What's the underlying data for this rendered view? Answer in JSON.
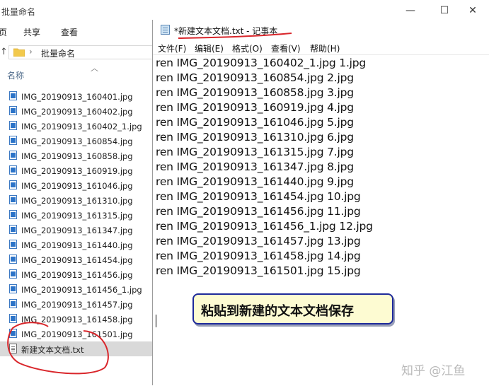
{
  "explorer": {
    "title": "批量命名",
    "ribbon": {
      "left_partial": "页",
      "share": "共享",
      "view": "查看"
    },
    "address": {
      "path_label": "批量命名"
    },
    "column_header": "名称",
    "files": [
      "IMG_20190913_160401.jpg",
      "IMG_20190913_160402.jpg",
      "IMG_20190913_160402_1.jpg",
      "IMG_20190913_160854.jpg",
      "IMG_20190913_160858.jpg",
      "IMG_20190913_160919.jpg",
      "IMG_20190913_161046.jpg",
      "IMG_20190913_161310.jpg",
      "IMG_20190913_161315.jpg",
      "IMG_20190913_161347.jpg",
      "IMG_20190913_161440.jpg",
      "IMG_20190913_161454.jpg",
      "IMG_20190913_161456.jpg",
      "IMG_20190913_161456_1.jpg",
      "IMG_20190913_161457.jpg",
      "IMG_20190913_161458.jpg",
      "IMG_20190913_161501.jpg",
      "新建文本文档.txt"
    ]
  },
  "window_controls": {
    "minimize": "—",
    "maximize": "☐",
    "close": "✕"
  },
  "notepad": {
    "title": "*新建文本文档.txt - 记事本",
    "menu": [
      "文件(F)",
      "编辑(E)",
      "格式(O)",
      "查看(V)",
      "帮助(H)"
    ],
    "lines": [
      "ren IMG_20190913_160402_1.jpg 1.jpg",
      "ren IMG_20190913_160854.jpg 2.jpg",
      "ren IMG_20190913_160858.jpg 3.jpg",
      "ren IMG_20190913_160919.jpg 4.jpg",
      "ren IMG_20190913_161046.jpg 5.jpg",
      "ren IMG_20190913_161310.jpg 6.jpg",
      "ren IMG_20190913_161315.jpg 7.jpg",
      "ren IMG_20190913_161347.jpg 8.jpg",
      "ren IMG_20190913_161440.jpg 9.jpg",
      "ren IMG_20190913_161454.jpg 10.jpg",
      "ren IMG_20190913_161456.jpg 11.jpg",
      "ren IMG_20190913_161456_1.jpg 12.jpg",
      "ren IMG_20190913_161457.jpg 13.jpg",
      "ren IMG_20190913_161458.jpg 14.jpg",
      "ren IMG_20190913_161501.jpg 15.jpg"
    ]
  },
  "callout": {
    "text": "粘贴到新建的文本文档保存"
  },
  "watermark": "知乎 @江鱼",
  "colors": {
    "annotation_red": "#d9262b",
    "callout_border": "#1e2a9a",
    "callout_fill": "#fdfbd2"
  }
}
